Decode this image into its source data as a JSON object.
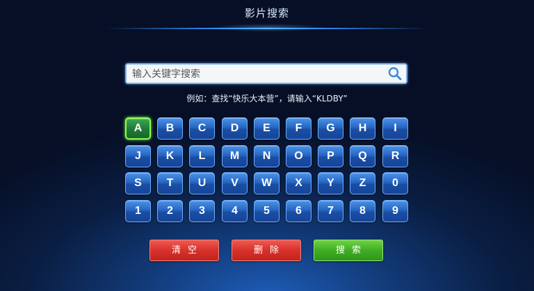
{
  "header": {
    "title": "影片搜索"
  },
  "search": {
    "placeholder": "输入关键字搜索",
    "value": "",
    "hint": "例如：查找“快乐大本营”，请输入“KLDBY”"
  },
  "keyboard": {
    "focused_key": "A",
    "rows": [
      [
        "A",
        "B",
        "C",
        "D",
        "E",
        "F",
        "G",
        "H",
        "I"
      ],
      [
        "J",
        "K",
        "L",
        "M",
        "N",
        "O",
        "P",
        "Q",
        "R"
      ],
      [
        "S",
        "T",
        "U",
        "V",
        "W",
        "X",
        "Y",
        "Z",
        "0"
      ],
      [
        "1",
        "2",
        "3",
        "4",
        "5",
        "6",
        "7",
        "8",
        "9"
      ]
    ]
  },
  "actions": {
    "clear_label": "清空",
    "delete_label": "删除",
    "search_label": "搜索"
  },
  "colors": {
    "key_blue": "#2566c4",
    "focus_green": "#8fff4a",
    "button_red": "#d8312b",
    "button_green": "#3fae24"
  }
}
